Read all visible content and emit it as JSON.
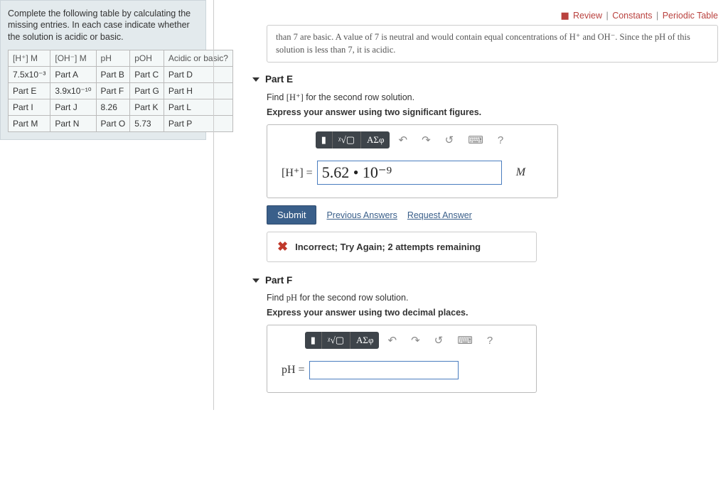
{
  "topLinks": {
    "review": "Review",
    "constants": "Constants",
    "periodic": "Periodic Table"
  },
  "left": {
    "instruction": "Complete the following table by calculating the missing entries. In each case indicate whether the solution is acidic or basic.",
    "headers": {
      "h1": "[H⁺] M",
      "h2": "[OH⁻] M",
      "h3": "pH",
      "h4": "pOH",
      "h5": "Acidic or basic?"
    },
    "rows": [
      {
        "c1": "7.5x10⁻³",
        "c2": "Part A",
        "c3": "Part B",
        "c4": "Part C",
        "c5": "Part D"
      },
      {
        "c1": "Part E",
        "c2": "3.9x10⁻¹⁰",
        "c3": "Part F",
        "c4": "Part G",
        "c5": "Part H"
      },
      {
        "c1": "Part I",
        "c2": "Part J",
        "c3": "8.26",
        "c4": "Part K",
        "c5": "Part L"
      },
      {
        "c1": "Part M",
        "c2": "Part N",
        "c3": "Part O",
        "c4": "5.73",
        "c5": "Part P"
      }
    ]
  },
  "hint": "than 7 are basic. A value of 7 is neutral and would contain equal concentrations of H⁺ and OH⁻. Since the pH of this solution is less than 7, it is acidic.",
  "partE": {
    "title": "Part E",
    "prompt_pre": "Find ",
    "prompt_var": "[H⁺]",
    "prompt_post": " for the second row solution.",
    "instruction": "Express your answer using two significant figures.",
    "label": "[H⁺] = ",
    "value": "5.62 • 10⁻⁹",
    "unit": "M",
    "submit": "Submit",
    "prev": "Previous Answers",
    "req": "Request Answer",
    "feedback": "Incorrect; Try Again; 2 attempts remaining"
  },
  "partF": {
    "title": "Part F",
    "prompt_pre": "Find ",
    "prompt_var": "pH",
    "prompt_post": " for the second row solution.",
    "instruction": "Express your answer using two decimal places.",
    "label": "pH = ",
    "value": ""
  },
  "toolbar": {
    "rect": "▮",
    "sqrt": "ᵡ√▢",
    "greek": "ΑΣφ",
    "undo": "↶",
    "redo": "↷",
    "reset": "↺",
    "keyboard": "⌨",
    "help": "?"
  }
}
